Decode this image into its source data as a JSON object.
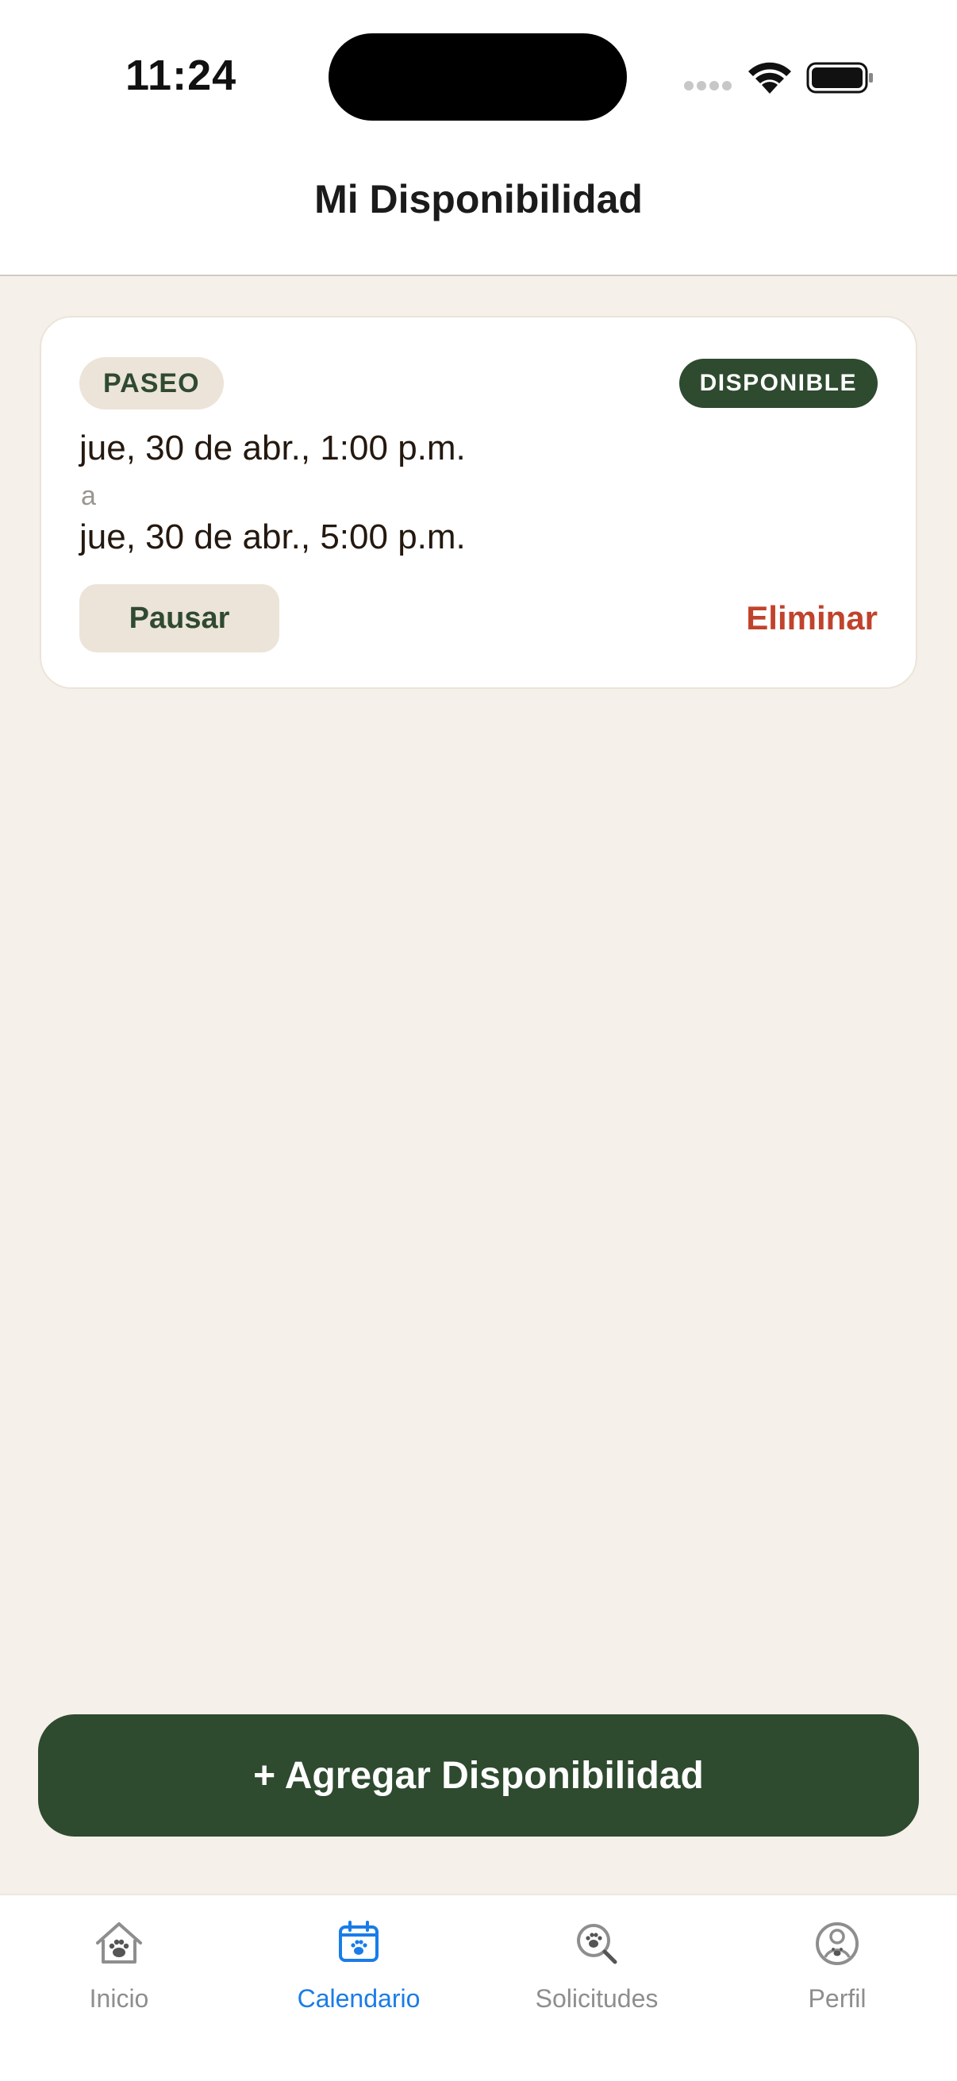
{
  "status_bar": {
    "time": "11:24"
  },
  "header": {
    "title": "Mi Disponibilidad"
  },
  "availability": [
    {
      "type": "PASEO",
      "status": "DISPONIBLE",
      "start": "jue, 30 de abr., 1:00 p.m.",
      "separator": "a",
      "end": "jue, 30 de abr., 5:00 p.m.",
      "pause_label": "Pausar",
      "delete_label": "Eliminar"
    }
  ],
  "add_button": {
    "label": "+ Agregar Disponibilidad"
  },
  "tabbar": {
    "items": [
      {
        "label": "Inicio",
        "icon": "home-paw-icon",
        "active": false
      },
      {
        "label": "Calendario",
        "icon": "calendar-paw-icon",
        "active": true
      },
      {
        "label": "Solicitudes",
        "icon": "search-paw-icon",
        "active": false
      },
      {
        "label": "Perfil",
        "icon": "profile-paw-icon",
        "active": false
      }
    ]
  },
  "colors": {
    "background": "#f5f0e9",
    "primary": "#2e4a2f",
    "tag": "#ece4d8",
    "danger": "#c0432b",
    "active_tab": "#1a7ce8",
    "inactive_tab": "#8e8e8e"
  }
}
